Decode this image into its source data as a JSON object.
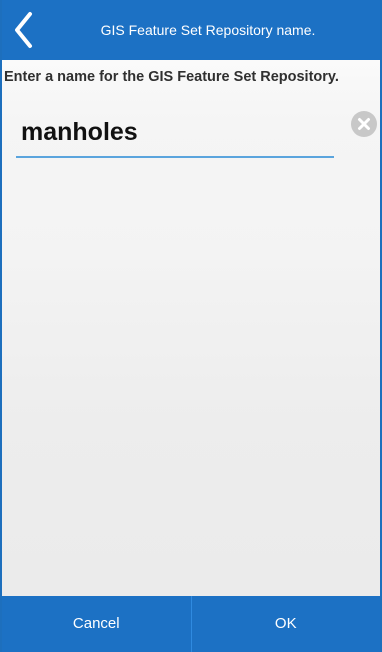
{
  "header": {
    "title": "GIS Feature Set Repository name.",
    "back_icon": "chevron-left-icon"
  },
  "prompt": {
    "text": "Enter a name for the GIS Feature Set Repository."
  },
  "name_field": {
    "value": "manholes",
    "clear_icon": "clear-circle-icon"
  },
  "footer": {
    "cancel_label": "Cancel",
    "ok_label": "OK"
  },
  "colors": {
    "accent": "#1c71c4",
    "underline": "#5aa4dd",
    "clear_icon_bg": "#c8c8c8"
  }
}
